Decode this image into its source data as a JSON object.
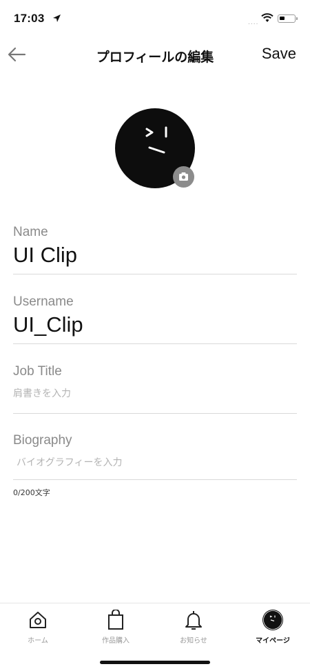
{
  "status_bar": {
    "time": "17:03",
    "signal": "....",
    "icons": [
      "location-arrow-icon",
      "wifi-icon",
      "battery-icon"
    ]
  },
  "header": {
    "title": "プロフィールの編集",
    "save_label": "Save",
    "back_icon": "back-arrow-icon"
  },
  "avatar": {
    "icon": "avatar-face",
    "camera_icon": "camera-icon"
  },
  "form": {
    "name": {
      "label": "Name",
      "value": "UI Clip"
    },
    "username": {
      "label": "Username",
      "value": "UI_Clip"
    },
    "job_title": {
      "label": "Job Title",
      "placeholder": "肩書きを入力"
    },
    "biography": {
      "label": "Biography",
      "placeholder": "バイオグラフィーを入力",
      "counter": "0/200文字"
    }
  },
  "tab_bar": {
    "items": [
      {
        "label": "ホーム",
        "icon": "home-icon",
        "active": false
      },
      {
        "label": "作品購入",
        "icon": "shopping-bag-icon",
        "active": false
      },
      {
        "label": "お知らせ",
        "icon": "bell-icon",
        "active": false
      },
      {
        "label": "マイページ",
        "icon": "avatar-icon",
        "active": true
      }
    ]
  },
  "colors": {
    "accent": "#111111",
    "muted": "#8a8a8a",
    "divider": "#d9d9d9",
    "camera_badge": "#8c8c8c"
  }
}
